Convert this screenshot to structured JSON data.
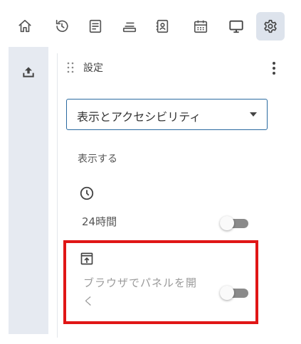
{
  "toolbar": {
    "icons": [
      "home-icon",
      "history-icon",
      "notes-icon",
      "stack-icon",
      "contacts-icon",
      "calendar-icon",
      "display-icon",
      "settings-icon"
    ],
    "active": "settings-icon"
  },
  "rail": {
    "icon": "upload-icon"
  },
  "panel": {
    "title": "設定",
    "menu_icon": "more-vertical-icon",
    "select": {
      "value": "表示とアクセシビリティ"
    },
    "section_label": "表示する",
    "settings": [
      {
        "icon": "clock-icon",
        "label": "24時間",
        "enabled": false
      },
      {
        "icon": "open-panel-icon",
        "label_line1": "ブラウザでパネルを開",
        "label_line2": "く",
        "enabled": false
      }
    ]
  },
  "colors": {
    "accent_border": "#2a6aa0",
    "highlight": "#e01616",
    "rail_bg": "#e6eaf1",
    "active_tab_bg": "#dde3ec"
  }
}
